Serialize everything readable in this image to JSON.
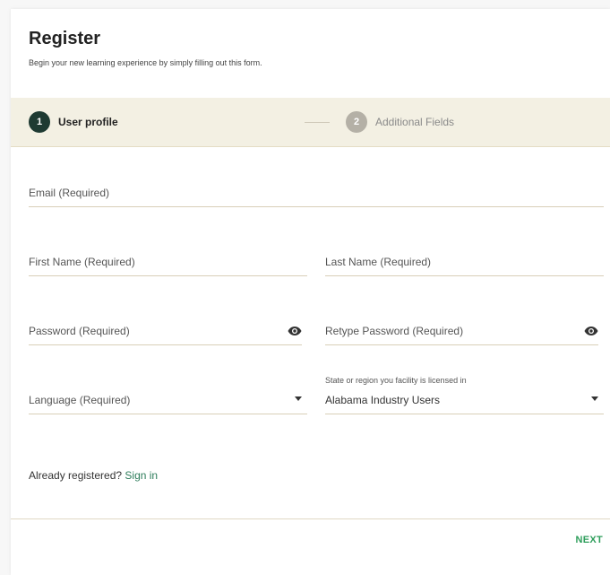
{
  "header": {
    "title": "Register",
    "subtitle": "Begin your new learning experience by simply filling out this form."
  },
  "stepper": {
    "steps": [
      {
        "number": "1",
        "label": "User profile",
        "state": "active"
      },
      {
        "number": "2",
        "label": "Additional Fields",
        "state": "inactive"
      }
    ]
  },
  "form": {
    "email": {
      "label": "Email  (Required)"
    },
    "first_name": {
      "label": "First Name  (Required)"
    },
    "last_name": {
      "label": "Last Name  (Required)"
    },
    "password": {
      "label": "Password (Required)",
      "icon": "eye-icon"
    },
    "retype_password": {
      "label": "Retype Password (Required)",
      "icon": "eye-icon"
    },
    "language": {
      "label": "Language (Required)",
      "icon": "caret-down-icon"
    },
    "state": {
      "label": "State or region you facility is licensed in",
      "value": "Alabama Industry Users",
      "icon": "caret-down-icon"
    }
  },
  "signin": {
    "prompt": "Already registered?",
    "link": "Sign in"
  },
  "footer": {
    "next_label": "NEXT"
  },
  "colors": {
    "stepper_bg": "#f3f0e3",
    "active_step": "#1e3a32",
    "inactive_step": "#b4b0a6",
    "accent": "#2e9e5b",
    "link": "#2e7d5b"
  }
}
